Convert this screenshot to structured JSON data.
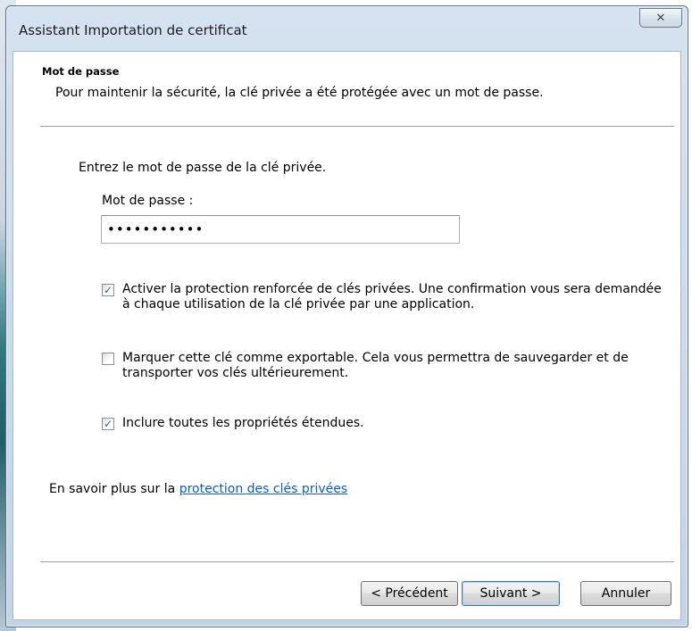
{
  "window": {
    "title": "Assistant Importation de certificat",
    "close_glyph": "✕"
  },
  "header": {
    "title": "Mot de passe",
    "subtitle": "Pour maintenir la sécurité, la clé privée a été protégée avec un mot de passe."
  },
  "form": {
    "instruction": "Entrez le mot de passe de la clé privée.",
    "password_label": "Mot de passe :",
    "password_value": "•••••••••••"
  },
  "options": [
    {
      "checked": true,
      "label": "Activer la protection renforcée de clés privées. Une confirmation vous sera demandée à chaque utilisation de la clé privée par une application."
    },
    {
      "checked": false,
      "label": "Marquer cette clé comme exportable. Cela vous permettra de sauvegarder et de transporter vos clés ultérieurement."
    },
    {
      "checked": true,
      "label": "Inclure toutes les propriétés étendues."
    }
  ],
  "learn_more": {
    "prefix": "En savoir plus sur la ",
    "link_text": "protection des clés privées"
  },
  "buttons": {
    "back": "< Précédent",
    "next": "Suivant >",
    "cancel": "Annuler"
  },
  "colors": {
    "link": "#0b5cc8",
    "checkmark": "#3b5b9e",
    "titlebar": "#c2d5e8"
  }
}
